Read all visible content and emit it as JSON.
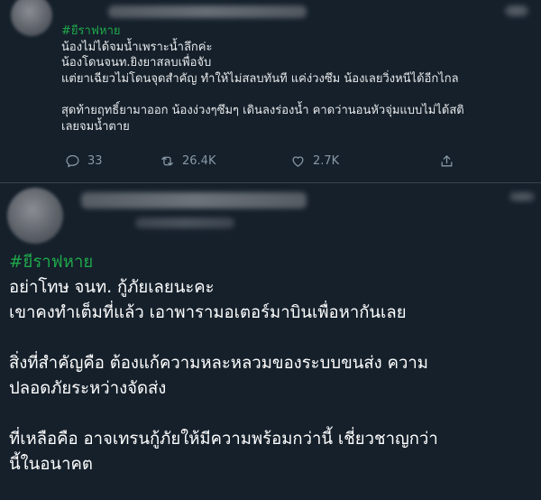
{
  "tweet1": {
    "lines": [
      "#ยีราฟหาย",
      "น้องไม่ได้จมน้ำเพราะน้ำลึกค่ะ",
      "น้องโดนจนท.ยิงยาสลบเพื่อจับ",
      "แต่ยาเฉียวไม่โดนจุดสำคัญ ทำให้ไม่สลบทันที แค่ง่วงซึม น้องเลยวิ่งหนีได้อีกไกล",
      "",
      "สุดท้ายฤทธิ์ยามาออก น้องง่วงๆซึมๆ เดินลงร่องน้ำ คาดว่านอนหัวจุ่มแบบไม่ได้สติ",
      "เลยจมน้ำตาย"
    ],
    "replies": "33",
    "retweets": "26.4K",
    "likes": "2.7K"
  },
  "tweet2": {
    "lines": [
      "#ยีราฟหาย",
      "อย่าโทษ จนท. กู้ภัยเลยนะคะ",
      "เขาคงทำเต็มที่แล้ว เอาพารามอเตอร์มาบินเพื่อหากันเลย",
      "",
      "สิ่งที่สำคัญคือ ต้องแก้ความหละหลวมของระบบขนส่ง ความ",
      "ปลอดภัยระหว่างจัดส่ง",
      "",
      "ที่เหลือคือ อาจเทรนกู้ภัยให้มีความพร้อมกว่านี้ เชี่ยวชาญกว่า",
      "นี้ในอนาคต"
    ]
  },
  "colors": {
    "background": "#15202b",
    "hashtag": "#1fa84a",
    "action": "#8899a6",
    "divider": "#38444d"
  },
  "icons": [
    "reply-icon",
    "retweet-icon",
    "like-icon",
    "share-icon"
  ]
}
